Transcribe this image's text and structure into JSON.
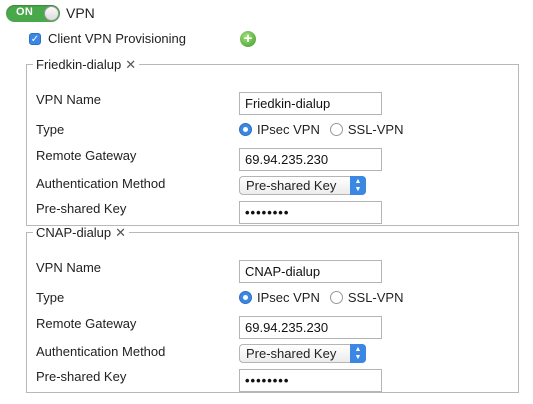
{
  "vpn": {
    "toggle_label": "ON",
    "label": "VPN"
  },
  "provisioning": {
    "label": "Client VPN Provisioning",
    "checked": true
  },
  "labels": {
    "vpn_name": "VPN Name",
    "type": "Type",
    "remote_gateway": "Remote Gateway",
    "auth_method": "Authentication Method",
    "psk": "Pre-shared Key"
  },
  "type_options": [
    "IPsec VPN",
    "SSL-VPN"
  ],
  "profiles": [
    {
      "title": "Friedkin-dialup",
      "vpn_name": "Friedkin-dialup",
      "type_selected": "IPsec VPN",
      "remote_gateway": "69.94.235.230",
      "auth_method": "Pre-shared Key",
      "psk_masked": "••••••••"
    },
    {
      "title": "CNAP-dialup",
      "vpn_name": "CNAP-dialup",
      "type_selected": "IPsec VPN",
      "remote_gateway": "69.94.235.230",
      "auth_method": "Pre-shared Key",
      "psk_masked": "••••••••"
    }
  ],
  "colors": {
    "toggle_on": "#49a849",
    "accent": "#3b88e4",
    "add_icon": "#4caf33"
  }
}
